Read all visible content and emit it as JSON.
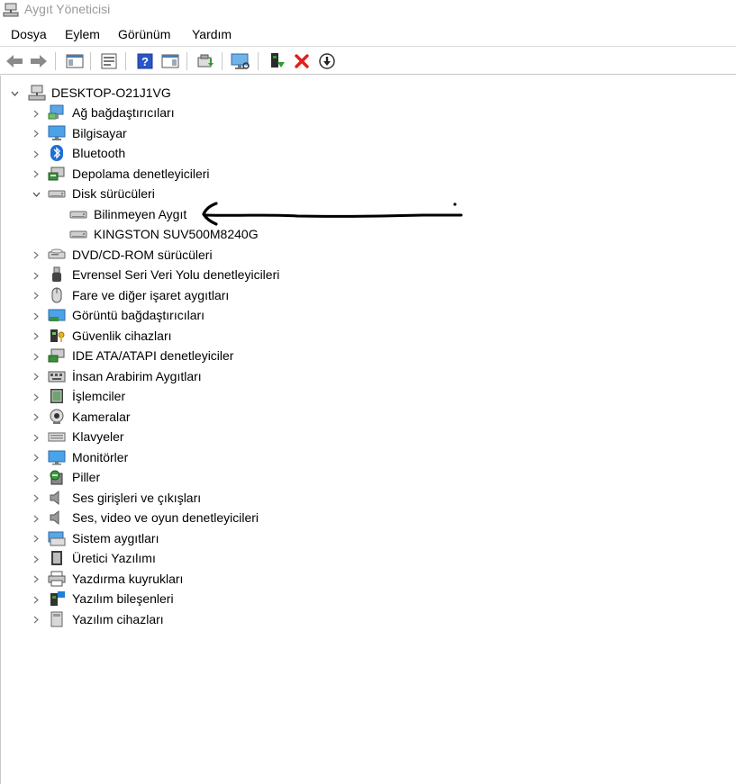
{
  "window": {
    "title": "Aygıt Yöneticisi"
  },
  "menu": {
    "file": "Dosya",
    "action": "Eylem",
    "view": "Görünüm",
    "help": "Yardım"
  },
  "tree": {
    "root": "DESKTOP-O21J1VG",
    "categories": [
      {
        "label": "Ağ bağdaştırıcıları",
        "icon": "network-adapter-icon"
      },
      {
        "label": "Bilgisayar",
        "icon": "computer-icon"
      },
      {
        "label": "Bluetooth",
        "icon": "bluetooth-icon"
      },
      {
        "label": "Depolama denetleyicileri",
        "icon": "storage-controller-icon"
      },
      {
        "label": "Disk sürücüleri",
        "icon": "disk-drive-icon",
        "expanded": true,
        "children": [
          {
            "label": "Bilinmeyen Aygıt",
            "icon": "disk-drive-icon"
          },
          {
            "label": "KINGSTON SUV500M8240G",
            "icon": "disk-drive-icon"
          }
        ]
      },
      {
        "label": "DVD/CD-ROM sürücüleri",
        "icon": "dvd-drive-icon"
      },
      {
        "label": "Evrensel Seri Veri Yolu denetleyicileri",
        "icon": "usb-icon"
      },
      {
        "label": "Fare ve diğer işaret aygıtları",
        "icon": "mouse-icon"
      },
      {
        "label": "Görüntü bağdaştırıcıları",
        "icon": "display-adapter-icon"
      },
      {
        "label": "Güvenlik cihazları",
        "icon": "security-device-icon"
      },
      {
        "label": "IDE ATA/ATAPI denetleyiciler",
        "icon": "ide-controller-icon"
      },
      {
        "label": "İnsan Arabirim Aygıtları",
        "icon": "hid-icon"
      },
      {
        "label": "İşlemciler",
        "icon": "processor-icon"
      },
      {
        "label": "Kameralar",
        "icon": "camera-icon"
      },
      {
        "label": "Klavyeler",
        "icon": "keyboard-icon"
      },
      {
        "label": "Monitörler",
        "icon": "monitor-icon"
      },
      {
        "label": "Piller",
        "icon": "battery-icon"
      },
      {
        "label": "Ses girişleri ve çıkışları",
        "icon": "speaker-icon"
      },
      {
        "label": "Ses, video ve oyun denetleyicileri",
        "icon": "sound-controller-icon"
      },
      {
        "label": "Sistem aygıtları",
        "icon": "system-device-icon"
      },
      {
        "label": "Üretici Yazılımı",
        "icon": "firmware-icon"
      },
      {
        "label": "Yazdırma kuyrukları",
        "icon": "printer-icon"
      },
      {
        "label": "Yazılım bileşenleri",
        "icon": "software-component-icon"
      },
      {
        "label": "Yazılım cihazları",
        "icon": "software-device-icon"
      }
    ]
  },
  "colors": {
    "accent_blue": "#1e7fd6",
    "uninstall_red": "#e0201c",
    "driver_green": "#2f9a2f"
  }
}
